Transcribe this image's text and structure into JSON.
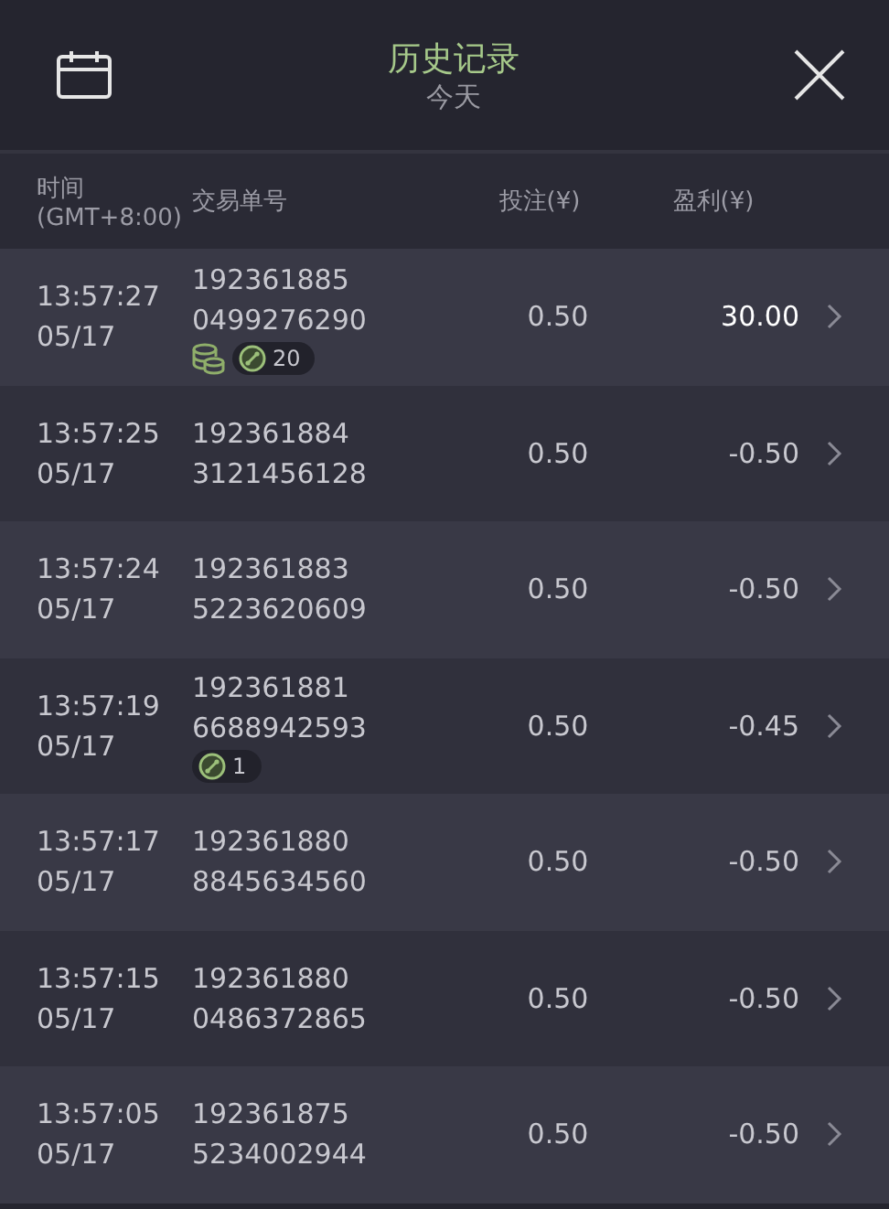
{
  "header": {
    "title": "历史记录",
    "subtitle": "今天"
  },
  "columns": [
    {
      "lines": [
        "时间",
        "(GMT+8:00)"
      ]
    },
    {
      "lines": [
        "交易单号"
      ]
    },
    {
      "lines": [
        "投注(¥)"
      ]
    },
    {
      "lines": [
        "盈利(¥)"
      ]
    }
  ],
  "rows": [
    {
      "time": "13:57:27",
      "date": "05/17",
      "order": [
        "192361885",
        "0499276290"
      ],
      "coins": true,
      "link_count": "20",
      "stake": "0.50",
      "profit": "30.00",
      "won": true
    },
    {
      "time": "13:57:25",
      "date": "05/17",
      "order": [
        "192361884",
        "3121456128"
      ],
      "coins": false,
      "stake": "0.50",
      "profit": "-0.50",
      "won": false
    },
    {
      "time": "13:57:24",
      "date": "05/17",
      "order": [
        "192361883",
        "5223620609"
      ],
      "coins": false,
      "stake": "0.50",
      "profit": "-0.50",
      "won": false
    },
    {
      "time": "13:57:19",
      "date": "05/17",
      "order": [
        "192361881",
        "6688942593"
      ],
      "coins": false,
      "link_count": "1",
      "stake": "0.50",
      "profit": "-0.45",
      "won": false
    },
    {
      "time": "13:57:17",
      "date": "05/17",
      "order": [
        "192361880",
        "8845634560"
      ],
      "coins": false,
      "stake": "0.50",
      "profit": "-0.50",
      "won": false
    },
    {
      "time": "13:57:15",
      "date": "05/17",
      "order": [
        "192361880",
        "0486372865"
      ],
      "coins": false,
      "stake": "0.50",
      "profit": "-0.50",
      "won": false
    },
    {
      "time": "13:57:05",
      "date": "05/17",
      "order": [
        "192361875",
        "5234002944"
      ],
      "coins": false,
      "stake": "0.50",
      "profit": "-0.50",
      "won": false
    }
  ]
}
